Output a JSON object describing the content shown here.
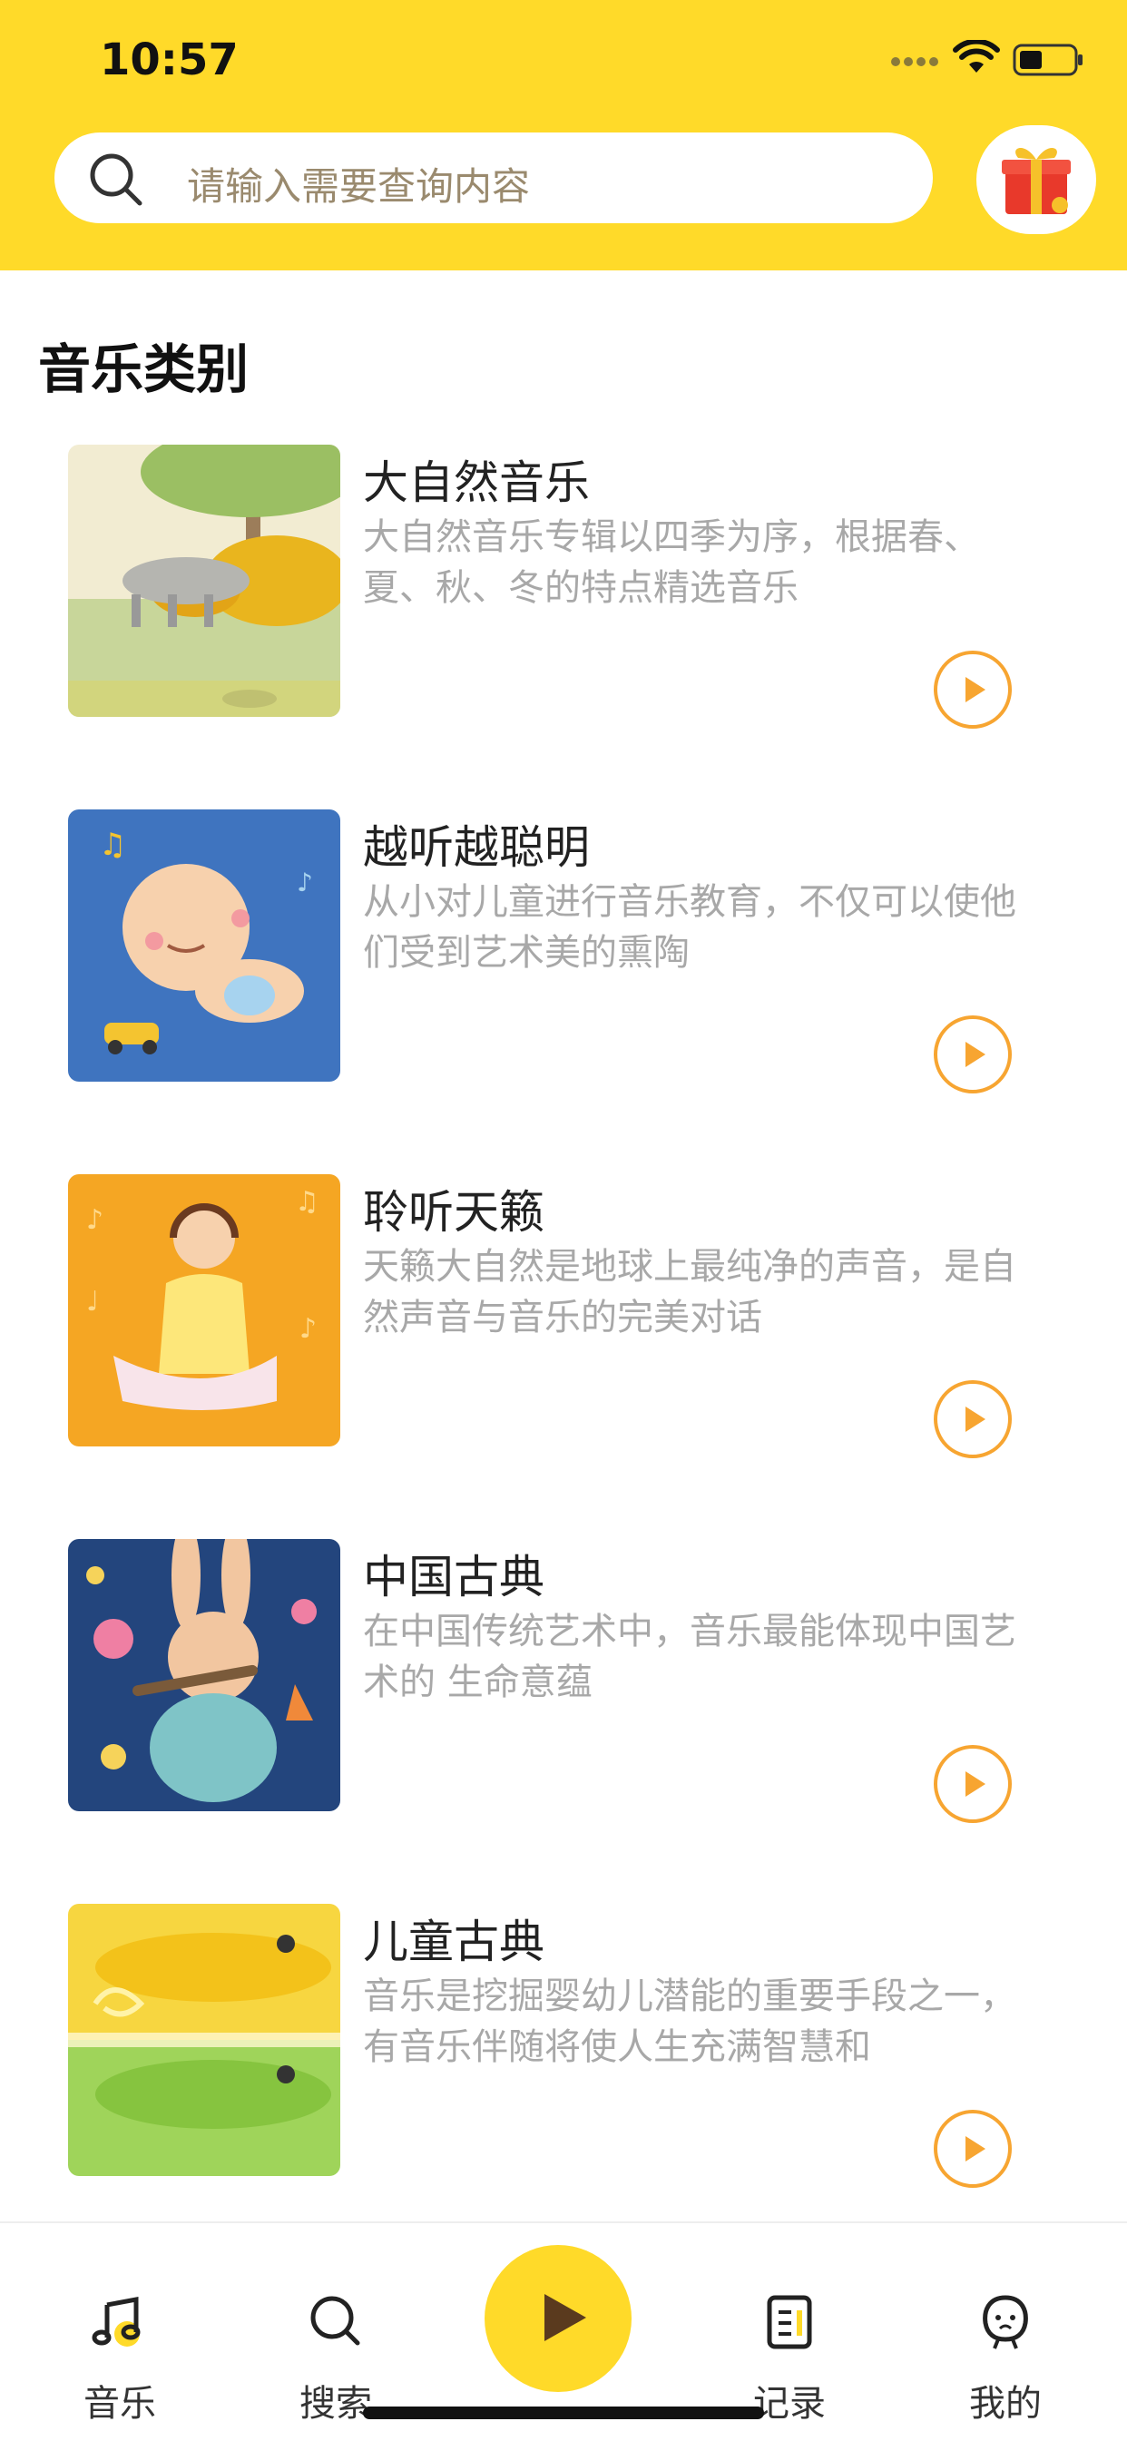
{
  "status": {
    "time": "10:57"
  },
  "search": {
    "placeholder": "请输入需要查询内容"
  },
  "section": {
    "title": "音乐类别"
  },
  "items": [
    {
      "title": "大自然音乐",
      "desc": "大自然音乐专辑以四季为序，根据春、夏、秋、冬的特点精选音乐"
    },
    {
      "title": "越听越聪明",
      "desc": "从小对儿童进行音乐教育，不仅可以使他们受到艺术美的熏陶"
    },
    {
      "title": "聆听天籁",
      "desc": "天籁大自然是地球上最纯净的声音，是自然声音与音乐的完美对话"
    },
    {
      "title": "中国古典",
      "desc": "在中国传统艺术中，音乐最能体现中国艺术的 生命意蕴"
    },
    {
      "title": "儿童古典",
      "desc": "音乐是挖掘婴幼儿潜能的重要手段之一，有音乐伴随将使人生充满智慧和"
    }
  ],
  "nav": {
    "music": "音乐",
    "search": "搜索",
    "records": "记录",
    "mine": "我的"
  },
  "colors": {
    "accent": "#FFDA29",
    "play_ring": "#F7A531",
    "play_triangle": "#F7A531"
  }
}
